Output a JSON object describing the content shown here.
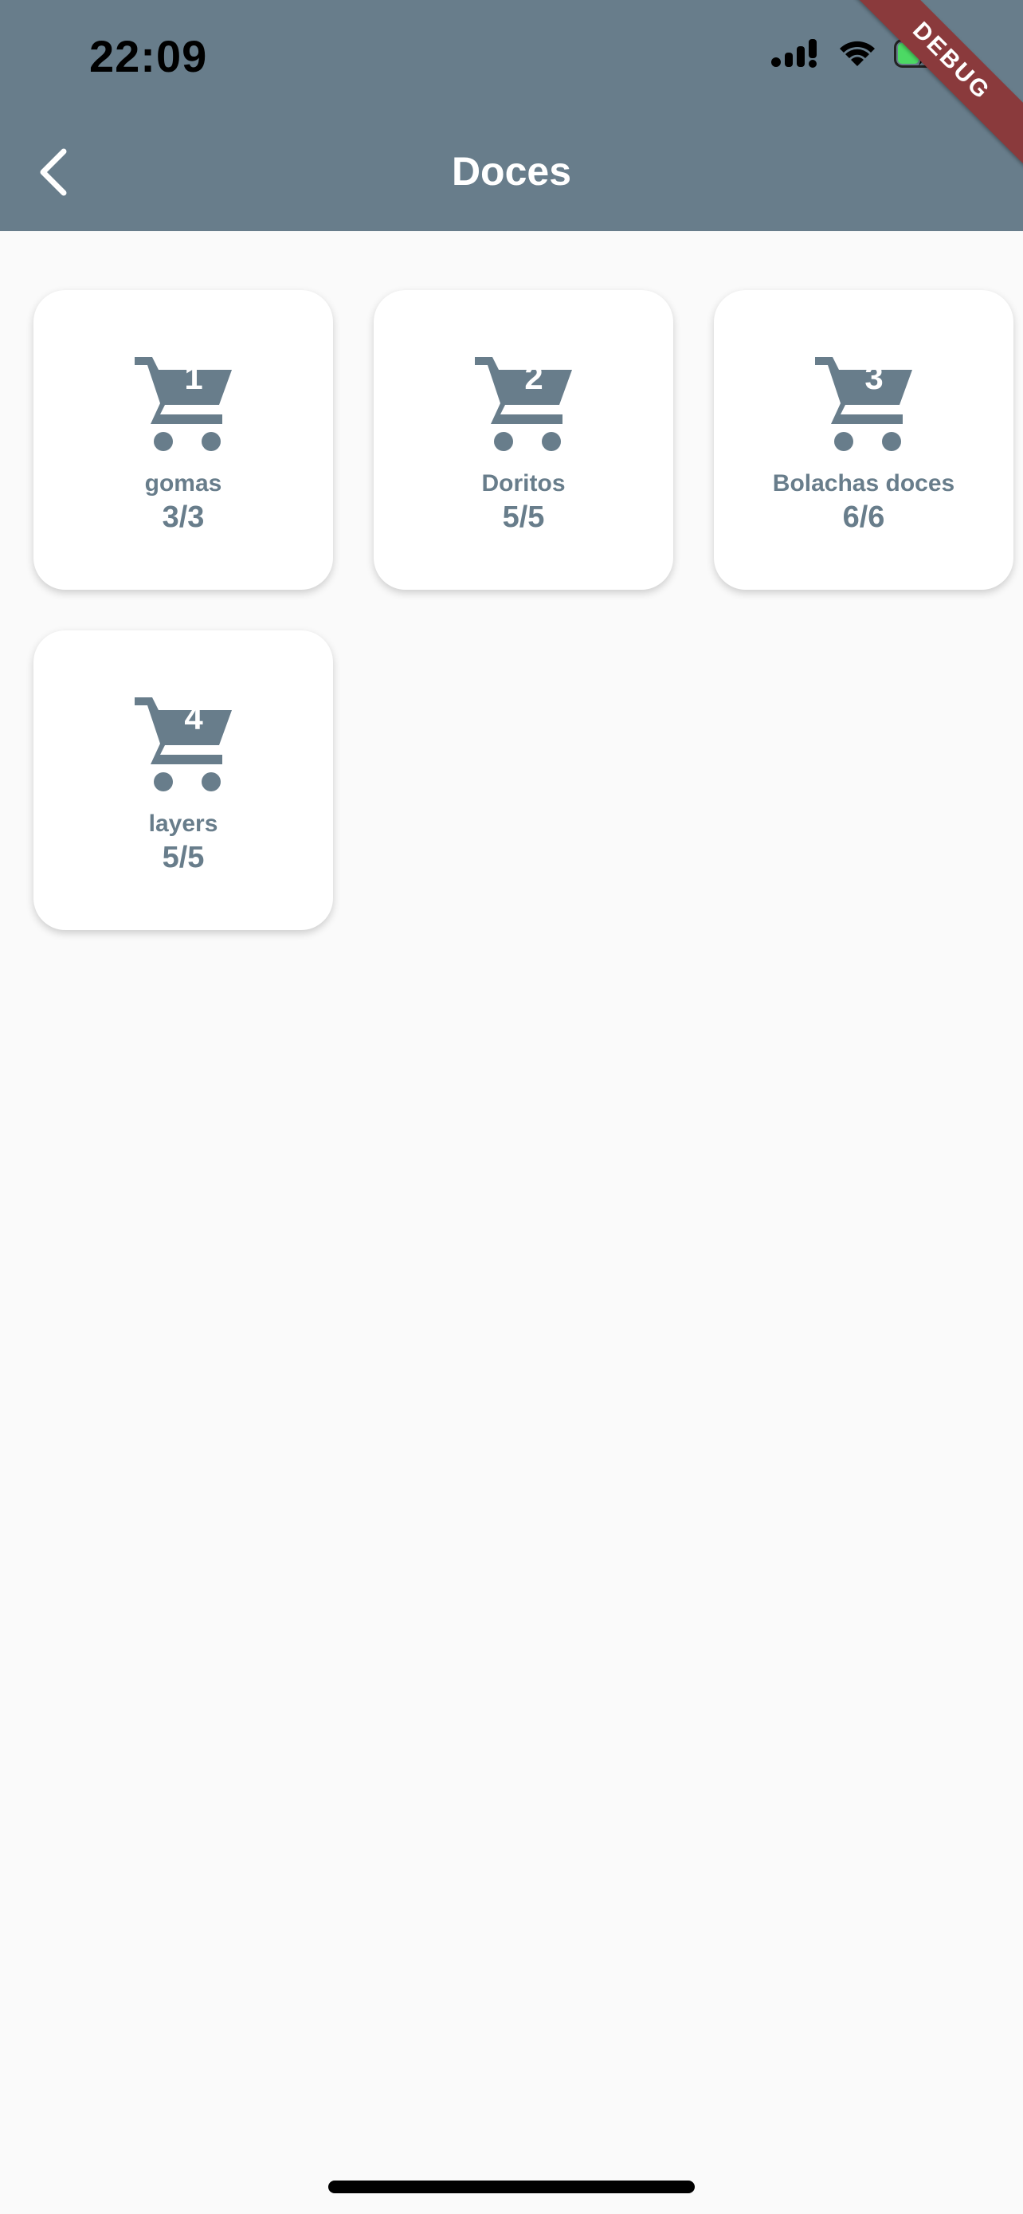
{
  "status_bar": {
    "time": "22:09"
  },
  "ribbon": {
    "label": "DEBUG"
  },
  "app_bar": {
    "title": "Doces"
  },
  "items": [
    {
      "number": "1",
      "name": "gomas",
      "count": "3/3"
    },
    {
      "number": "2",
      "name": "Doritos",
      "count": "5/5"
    },
    {
      "number": "3",
      "name": "Bolachas doces",
      "count": "6/6"
    },
    {
      "number": "4",
      "name": "layers",
      "count": "5/5"
    }
  ],
  "colors": {
    "app_bar": "#687d8b",
    "accent": "#687d8b",
    "background": "#fafafa",
    "ribbon": "#8a3a3c"
  }
}
